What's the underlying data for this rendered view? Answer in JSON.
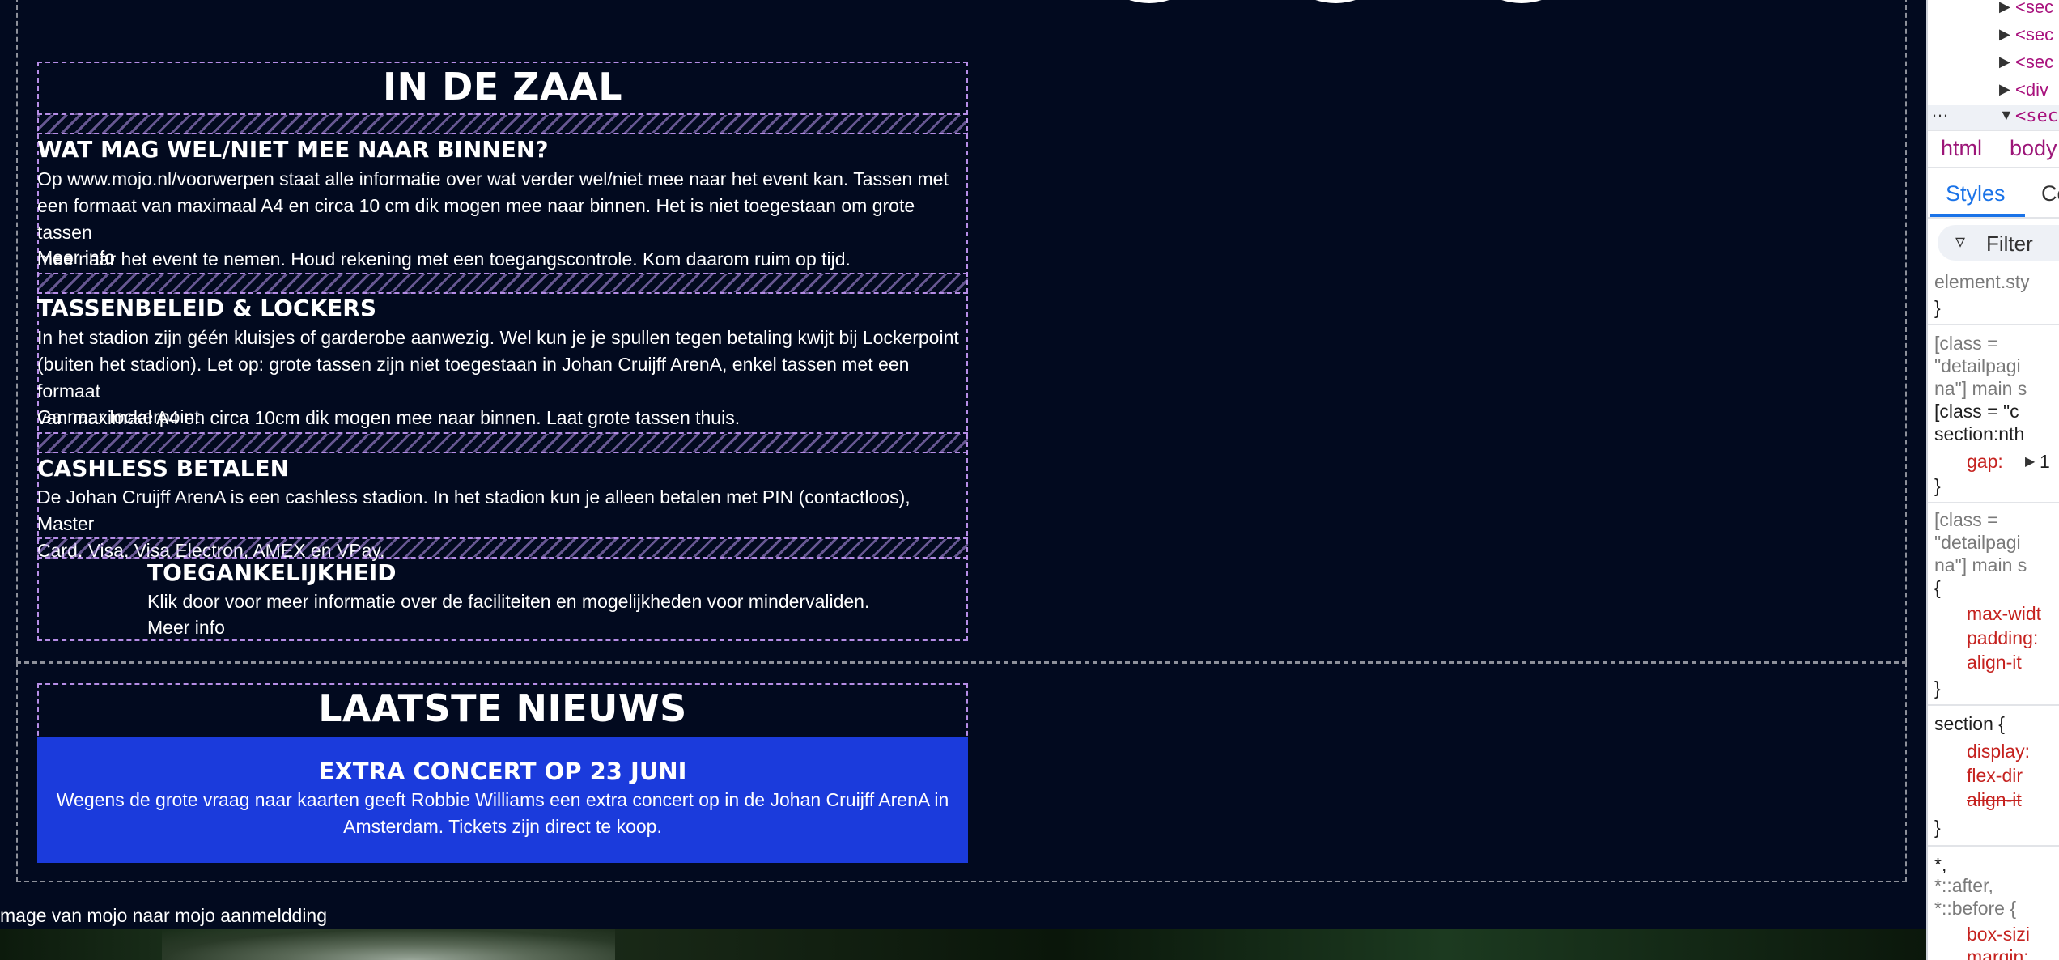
{
  "page": {
    "zaal": {
      "title": "IN DE ZAAL",
      "items": [
        {
          "title": "WAT MAG WEL/NIET MEE NAAR BINNEN?",
          "lines": [
            "Op www.mojo.nl/voorwerpen staat alle informatie over wat verder wel/niet mee naar het event kan. Tassen met",
            "een formaat van maximaal A4 en circa 10 cm dik mogen mee naar binnen. Het is niet toegestaan om grote tassen",
            "mee naar het event te nemen. Houd rekening met een toegangscontrole. Kom daarom ruim op tijd."
          ],
          "link": "Meer info"
        },
        {
          "title": "TASSENBELEID & LOCKERS",
          "lines": [
            "In het stadion zijn géén kluisjes of garderobe aanwezig. Wel kun je je spullen tegen betaling kwijt bij Lockerpoint",
            "(buiten het stadion). Let op: grote tassen zijn niet toegestaan in Johan Cruijff ArenA, enkel tassen met een formaat",
            "van maximaal A4 en circa 10cm dik mogen mee naar binnen. Laat grote tassen thuis."
          ],
          "link": "Ga naar lockerpoint"
        },
        {
          "title": "CASHLESS BETALEN",
          "lines": [
            "De Johan Cruijff ArenA is een cashless stadion. In het stadion kun je alleen betalen met PIN (contactloos), Master",
            "Card, Visa, Visa Electron, AMEX en VPay."
          ]
        },
        {
          "title": "TOEGANKELIJKHEID",
          "lines": [
            "Klik door voor meer informatie over de faciliteiten en mogelijkheden voor mindervaliden."
          ],
          "link": "Meer info"
        }
      ]
    },
    "news": {
      "title": "LAATSTE NIEUWS",
      "card_title": "EXTRA CONCERT OP 23 JUNI",
      "card_lines": [
        "Wegens de grote vraag naar kaarten geeft Robbie Williams een extra concert op in de Johan Cruijff ArenA in",
        "Amsterdam. Tickets zijn direct te koop."
      ]
    },
    "image_alt": "mage van mojo naar mojo aanmeldding"
  },
  "devtools": {
    "dom_nodes": [
      "<sec",
      "<sec",
      "<sec",
      "<div",
      "<sec"
    ],
    "breadcrumb": [
      "html",
      "body"
    ],
    "tabs": [
      "Styles",
      "Co"
    ],
    "filter_placeholder": "Filter",
    "rules": [
      "element.sty",
      "}",
      "[class =",
      "\"detailpagi",
      "na\"] main s",
      "[class = \"c",
      "section:nth",
      "gap:",
      "1",
      "}",
      "[class =",
      "\"detailpagi",
      "na\"] main s",
      "{",
      "max-widt",
      "padding:",
      "align-it",
      "}",
      "section {",
      "display:",
      "flex-dir",
      "align-it",
      "}",
      "*,",
      "*::after,",
      "*::before {",
      "box-sizi",
      "margin:"
    ]
  },
  "colors": {
    "page_bg": "#020a1f",
    "news_card": "#1b3bdc",
    "dash_purple": "#b68de6",
    "devtools_tag": "#a8117d",
    "devtools_prop": "#c5221f",
    "devtools_tab_active": "#1a73e8"
  }
}
